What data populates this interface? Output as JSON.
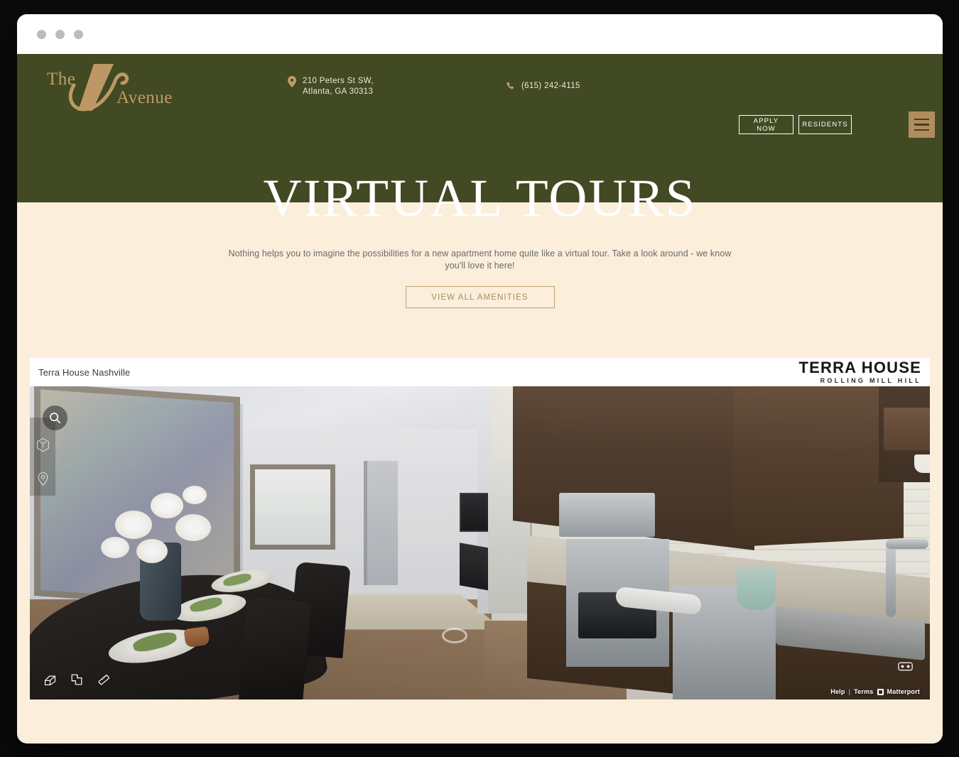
{
  "browser": {
    "window_dots": 3
  },
  "header": {
    "logo": {
      "line1": "The",
      "line2": "Avenue",
      "monogram": "A"
    },
    "address": {
      "line1": "210 Peters St SW,",
      "line2": "Atlanta, GA 30313",
      "icon": "map-pin-icon"
    },
    "phone": {
      "number": "(615) 242-4115",
      "icon": "phone-icon"
    },
    "buttons": {
      "apply": "APPLY NOW",
      "residents": "RESIDENTS"
    },
    "menu_icon": "hamburger-menu-icon",
    "page_title": "VIRTUAL TOURS",
    "colors": {
      "background": "#414a22",
      "accent": "#b08d5e",
      "title": "#ffffff"
    }
  },
  "intro": {
    "paragraph": "Nothing helps you to imagine the possibilities for a new apartment home quite like a virtual tour. Take a look around - we know you'll love it here!",
    "cta_label": "VIEW ALL AMENITIES",
    "colors": {
      "background": "#fbeedb",
      "cta_border": "#c3a276",
      "cta_text": "#a98c62"
    }
  },
  "viewer": {
    "title": "Terra House Nashville",
    "brand": {
      "name": "TERRA HOUSE",
      "tagline": "ROLLING MILL HILL"
    },
    "controls": {
      "search": "search-icon",
      "dollhouse": "dollhouse-cube-icon",
      "location": "location-pin-icon",
      "dollhouse_view": "dollhouse-view-icon",
      "floorplan_view": "floorplan-icon",
      "measurement": "measurement-tape-icon",
      "vr": "vr-goggles-icon"
    },
    "credit": {
      "help": "Help",
      "separator": "|",
      "terms": "Terms",
      "brand": "Matterport"
    },
    "scene_description": "360 panorama of a furnished apartment: dining table in the foreground, living room with sofa and ceiling fan at center, and a kitchen with dark cabinets, stainless appliances and granite countertops at right."
  }
}
